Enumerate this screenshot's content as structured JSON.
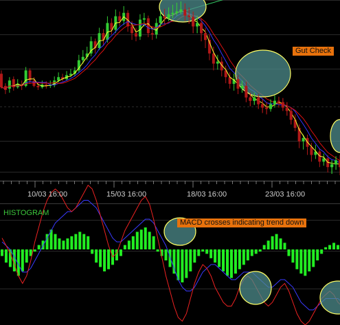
{
  "colors": {
    "background": "#000000",
    "grid": "#2a2a2a",
    "bull": "#33cc33",
    "bear": "#b01818",
    "fast_ma": "#ffff33",
    "slow_ma": "#dd1111",
    "mid_ma": "#3333ff",
    "trend": "#33cc66",
    "histogram": "#22ee22",
    "macd": "#3a3aff",
    "signal": "#ee2222",
    "annotation_bg": "#e8720c",
    "highlight_fill": "#4d8c8c",
    "highlight_stroke": "#ffff66"
  },
  "chart_data": [
    {
      "type": "candlestick",
      "x_tick_labels": [
        "10/03 16:00",
        "15/03 16:00",
        "18/03 16:00",
        "23/03 16:00"
      ],
      "annotations": [
        "Gut Check"
      ],
      "candles": [
        [
          90,
          70,
          95,
          68
        ],
        [
          72,
          66,
          76,
          60
        ],
        [
          68,
          80,
          85,
          62
        ],
        [
          82,
          70,
          86,
          65
        ],
        [
          70,
          75,
          82,
          68
        ],
        [
          74,
          72,
          80,
          66
        ],
        [
          72,
          95,
          100,
          70
        ],
        [
          95,
          80,
          98,
          75
        ],
        [
          80,
          72,
          85,
          70
        ],
        [
          72,
          70,
          78,
          66
        ],
        [
          70,
          74,
          80,
          68
        ],
        [
          74,
          72,
          79,
          68
        ],
        [
          72,
          73,
          80,
          69
        ],
        [
          73,
          80,
          86,
          70
        ],
        [
          80,
          85,
          92,
          77
        ],
        [
          85,
          82,
          90,
          79
        ],
        [
          82,
          88,
          94,
          80
        ],
        [
          88,
          90,
          97,
          85
        ],
        [
          90,
          95,
          100,
          86
        ],
        [
          95,
          110,
          118,
          92
        ],
        [
          110,
          115,
          125,
          105
        ],
        [
          115,
          120,
          130,
          110
        ],
        [
          120,
          138,
          145,
          116
        ],
        [
          138,
          128,
          142,
          120
        ],
        [
          128,
          150,
          158,
          125
        ],
        [
          150,
          140,
          156,
          132
        ],
        [
          140,
          165,
          175,
          136
        ],
        [
          165,
          155,
          172,
          148
        ],
        [
          155,
          175,
          185,
          150
        ],
        [
          175,
          168,
          182,
          160
        ],
        [
          168,
          180,
          190,
          162
        ],
        [
          180,
          160,
          184,
          152
        ],
        [
          160,
          150,
          168,
          140
        ],
        [
          150,
          145,
          158,
          138
        ],
        [
          145,
          170,
          178,
          140
        ],
        [
          170,
          172,
          180,
          160
        ],
        [
          172,
          150,
          176,
          144
        ],
        [
          150,
          148,
          160,
          140
        ],
        [
          148,
          165,
          172,
          142
        ],
        [
          165,
          175,
          182,
          160
        ],
        [
          175,
          172,
          186,
          164
        ],
        [
          172,
          178,
          188,
          168
        ],
        [
          178,
          180,
          192,
          172
        ],
        [
          180,
          182,
          195,
          176
        ],
        [
          182,
          185,
          197,
          178
        ],
        [
          185,
          176,
          194,
          168
        ],
        [
          176,
          174,
          188,
          164
        ],
        [
          174,
          160,
          182,
          150
        ],
        [
          160,
          165,
          176,
          150
        ],
        [
          165,
          150,
          172,
          138
        ],
        [
          150,
          140,
          158,
          128
        ],
        [
          140,
          120,
          148,
          110
        ],
        [
          120,
          105,
          130,
          95
        ],
        [
          105,
          108,
          118,
          96
        ],
        [
          108,
          95,
          115,
          86
        ],
        [
          95,
          85,
          102,
          76
        ],
        [
          85,
          75,
          92,
          68
        ],
        [
          75,
          82,
          90,
          65
        ],
        [
          82,
          68,
          88,
          60
        ],
        [
          68,
          72,
          80,
          62
        ],
        [
          72,
          55,
          78,
          48
        ],
        [
          55,
          50,
          62,
          42
        ],
        [
          50,
          55,
          62,
          44
        ],
        [
          55,
          45,
          60,
          38
        ],
        [
          45,
          40,
          52,
          32
        ],
        [
          40,
          38,
          48,
          30
        ],
        [
          38,
          45,
          52,
          34
        ],
        [
          45,
          50,
          58,
          40
        ],
        [
          50,
          48,
          56,
          40
        ],
        [
          48,
          40,
          54,
          35
        ],
        [
          40,
          35,
          48,
          28
        ],
        [
          35,
          22,
          40,
          15
        ],
        [
          22,
          10,
          30,
          5
        ],
        [
          10,
          -10,
          15,
          -20
        ],
        [
          -10,
          -5,
          0,
          -22
        ],
        [
          -5,
          -18,
          0,
          -30
        ],
        [
          -18,
          -30,
          -12,
          -40
        ],
        [
          -30,
          -25,
          -15,
          -36
        ],
        [
          -25,
          -40,
          -20,
          -48
        ],
        [
          -40,
          -35,
          -28,
          -46
        ],
        [
          -35,
          -48,
          -30,
          -56
        ],
        [
          -48,
          -44,
          -38,
          -58
        ],
        [
          -44,
          -38,
          -32,
          -52
        ],
        [
          -38,
          -48,
          -30,
          -60
        ]
      ]
    },
    {
      "type": "histogram",
      "title": "HISTOGRAM",
      "annotations": [
        "MACD crosses indicating trend down"
      ],
      "values": [
        -3,
        -6,
        -8,
        -10,
        -12,
        -10,
        -6,
        -3,
        -1,
        2,
        4,
        7,
        9,
        7,
        5,
        4,
        5,
        6,
        7,
        8,
        7,
        6,
        -2,
        -6,
        -8,
        -10,
        -9,
        -7,
        -5,
        -3,
        2,
        4,
        6,
        8,
        9,
        10,
        8,
        6,
        -1,
        -3,
        -5,
        -8,
        -11,
        -14,
        -15,
        -13,
        -10,
        -6,
        -3,
        -1,
        -2,
        -4,
        -6,
        -8,
        -10,
        -12,
        -13,
        -11,
        -9,
        -7,
        -5,
        -3,
        -2,
        -1,
        2,
        4,
        6,
        7,
        5,
        3,
        -3,
        -6,
        -9,
        -11,
        -12,
        -10,
        -8,
        -5,
        -2,
        1,
        2,
        3,
        2
      ],
      "macd": [
        2,
        1,
        0,
        -2,
        -4,
        -6,
        -6,
        -5,
        -3,
        -1,
        1,
        3,
        5,
        7,
        8,
        9,
        10,
        10,
        11,
        12,
        13,
        13,
        12,
        11,
        9,
        7,
        5,
        3,
        2,
        2,
        3,
        4,
        5,
        6,
        7,
        8,
        8,
        7,
        5,
        3,
        1,
        -2,
        -5,
        -8,
        -10,
        -11,
        -11,
        -10,
        -8,
        -6,
        -5,
        -4,
        -4,
        -5,
        -6,
        -7,
        -8,
        -8,
        -7,
        -6,
        -6,
        -6,
        -7,
        -8,
        -9,
        -10,
        -10,
        -9,
        -8,
        -8,
        -9,
        -10,
        -12,
        -14,
        -15,
        -16,
        -16,
        -15,
        -14,
        -13,
        -13,
        -13,
        -13,
        -14
      ],
      "signal": [
        3,
        1,
        -1,
        -4,
        -7,
        -9,
        -7,
        -3,
        2,
        6,
        10,
        13,
        15,
        16,
        15,
        13,
        11,
        10,
        11,
        13,
        15,
        17,
        16,
        13,
        9,
        5,
        1,
        -2,
        -1,
        2,
        5,
        7,
        9,
        11,
        13,
        14,
        12,
        8,
        3,
        -2,
        -7,
        -11,
        -15,
        -18,
        -19,
        -17,
        -13,
        -9,
        -6,
        -4,
        -5,
        -7,
        -10,
        -12,
        -14,
        -15,
        -15,
        -13,
        -10,
        -8,
        -7,
        -8,
        -10,
        -12,
        -14,
        -15,
        -14,
        -12,
        -10,
        -9,
        -11,
        -14,
        -17,
        -19,
        -20,
        -19,
        -17,
        -15,
        -13,
        -12,
        -11,
        -12,
        -14,
        -15
      ]
    }
  ]
}
